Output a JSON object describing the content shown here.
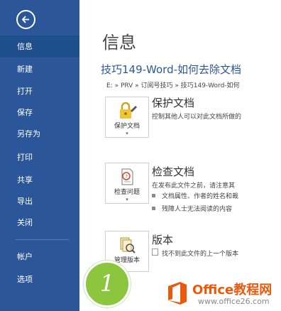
{
  "sidebar": {
    "items": [
      {
        "label": "信息"
      },
      {
        "label": "新建"
      },
      {
        "label": "打开"
      },
      {
        "label": "保存"
      },
      {
        "label": "另存为"
      },
      {
        "label": "打印"
      },
      {
        "label": "共享"
      },
      {
        "label": "导出"
      },
      {
        "label": "关闭"
      },
      {
        "label": "帐户"
      },
      {
        "label": "选项"
      }
    ],
    "active_index": 0
  },
  "main": {
    "page_title": "信息",
    "doc_title": "技巧149-Word-如何去除文档",
    "doc_path": "E: » PRV » 订阅号技巧 » 技巧149-Word-如何",
    "sections": [
      {
        "tile_label": "保护文档",
        "title": "保护文档",
        "description": "控制其他人可以对此文档所做的",
        "icon": "lock-icon"
      },
      {
        "tile_label": "检查问题",
        "title": "检查文档",
        "description": "在发布此文件之前，请注意其",
        "bullets": [
          "文档属性、作者的姓名和裁",
          "残障人士无法阅读的内容"
        ],
        "icon": "inspect-icon"
      },
      {
        "tile_label": "管理版本",
        "title": "版本",
        "description": "找不到此文件的上一个版本",
        "icon": "versions-icon"
      }
    ]
  },
  "step_badge": "1",
  "watermark": {
    "main": "Office教程网",
    "sub": "www.office26.com"
  },
  "colors": {
    "sidebar": "#2b579a",
    "badge": "#8cc63f",
    "watermark": "#e95a0c"
  }
}
